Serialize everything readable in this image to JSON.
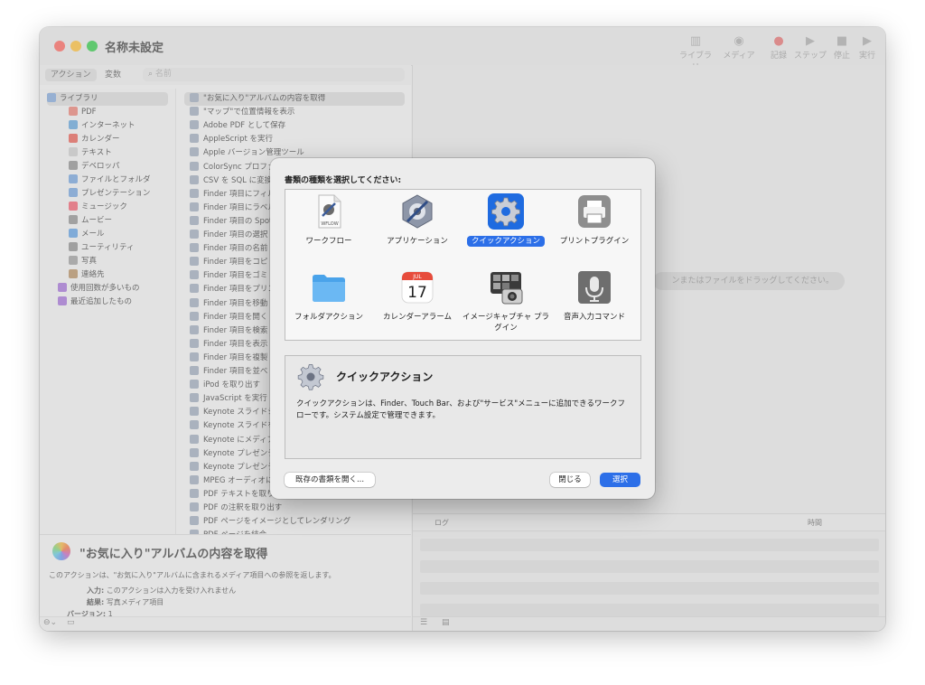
{
  "window": {
    "title": "名称未設定"
  },
  "toolbar": [
    {
      "label": "ライブラリ",
      "icon": "library-icon",
      "glyph": "▥"
    },
    {
      "label": "メディア",
      "icon": "media-icon",
      "glyph": "◉"
    },
    {
      "label": "記録",
      "icon": "record-icon",
      "glyph": "●"
    },
    {
      "label": "ステップ",
      "icon": "step-icon",
      "glyph": "▶︎"
    },
    {
      "label": "停止",
      "icon": "stop-icon",
      "glyph": "■"
    },
    {
      "label": "実行",
      "icon": "run-icon",
      "glyph": "▶"
    }
  ],
  "tabs": {
    "actions": "アクション",
    "variables": "変数"
  },
  "search": {
    "placeholder": "名前",
    "glyph": "⌕"
  },
  "sidebar": {
    "items": [
      {
        "label": "ライブラリ",
        "color": "#7da3d8"
      },
      {
        "label": "PDF",
        "color": "#e97b6f"
      },
      {
        "label": "インターネット",
        "color": "#5da0d9"
      },
      {
        "label": "カレンダー",
        "color": "#e6584e"
      },
      {
        "label": "テキスト",
        "color": "#c9c9c9"
      },
      {
        "label": "デベロッパ",
        "color": "#8b8b8b"
      },
      {
        "label": "ファイルとフォルダ",
        "color": "#6d9fdb"
      },
      {
        "label": "プレゼンテーション",
        "color": "#6d9fdb"
      },
      {
        "label": "ミュージック",
        "color": "#f05a6a"
      },
      {
        "label": "ムービー",
        "color": "#8d8d8d"
      },
      {
        "label": "メール",
        "color": "#5a9be0"
      },
      {
        "label": "ユーティリティ",
        "color": "#8b8b8b"
      },
      {
        "label": "写真",
        "color": "#9a9a9a"
      },
      {
        "label": "連絡先",
        "color": "#b38a5c"
      },
      {
        "label": "使用回数が多いもの",
        "color": "#a06cd6"
      },
      {
        "label": "最近追加したもの",
        "color": "#a06cd6"
      }
    ]
  },
  "actions": [
    "\"お気に入り\"アルバムの内容を取得",
    "\"マップ\"で位置情報を表示",
    "Adobe PDF として保存",
    "AppleScript を実行",
    "Apple バージョン管理ツール",
    "ColorSync プロファ",
    "CSV を SQL に変換",
    "Finder 項目にフィル",
    "Finder 項目にラベル",
    "Finder 項目の Spot",
    "Finder 項目の選択",
    "Finder 項目の名前",
    "Finder 項目をコピ",
    "Finder 項目をゴミ",
    "Finder 項目をプリン",
    "Finder 項目を移動",
    "Finder 項目を開く",
    "Finder 項目を検索",
    "Finder 項目を表示",
    "Finder 項目を複製",
    "Finder 項目を並べ",
    "iPod を取り出す",
    "JavaScript を実行",
    "Keynote スライドシ",
    "Keynote スライドを",
    "Keynote にメディア",
    "Keynote プレゼンテ",
    "Keynote プレゼンテ",
    "MPEG オーディオに",
    "PDF テキストを取り",
    "PDF の注釈を取り出す",
    "PDF ページをイメージとしてレンダリング",
    "PDF ページを結合"
  ],
  "description": {
    "title": "\"お気に入り\"アルバムの内容を取得",
    "text": "このアクションは、\"お気に入り\"アルバムに含まれるメディア項目への参照を返します。",
    "input_key": "入力:",
    "input_value": "このアクションは入力を受け入れません",
    "result_key": "結果:",
    "result_value": "写真メディア項目",
    "version_key": "バージョン:",
    "version_value": "1"
  },
  "workflow": {
    "drop_hint": "ンまたはファイルをドラッグしてください。"
  },
  "log": {
    "col_log": "ログ",
    "col_time": "時間"
  },
  "dialog": {
    "prompt": "書類の種類を選択してください:",
    "types": [
      {
        "label": "ワークフロー",
        "icon": "workflow-document-icon"
      },
      {
        "label": "アプリケーション",
        "icon": "application-icon"
      },
      {
        "label": "クイックアクション",
        "icon": "gear-icon",
        "selected": true
      },
      {
        "label": "プリントプラグイン",
        "icon": "printer-icon"
      },
      {
        "label": "フォルダアクション",
        "icon": "folder-icon"
      },
      {
        "label": "カレンダーアラーム",
        "icon": "calendar-icon",
        "cal_month": "JUL",
        "cal_day": "17"
      },
      {
        "label": "イメージキャプチャ プラグイン",
        "icon": "image-capture-icon"
      },
      {
        "label": "音声入力コマンド",
        "icon": "microphone-icon"
      }
    ],
    "workflow_doc_label": "WFLOW",
    "info_title": "クイックアクション",
    "info_desc": "クイックアクションは、Finder、Touch Bar、および\"サービス\"メニューに追加できるワークフローです。システム設定で管理できます。",
    "open_existing": "既存の書類を開く...",
    "close": "閉じる",
    "choose": "選択"
  },
  "colors": {
    "accent": "#2c6fe8"
  }
}
